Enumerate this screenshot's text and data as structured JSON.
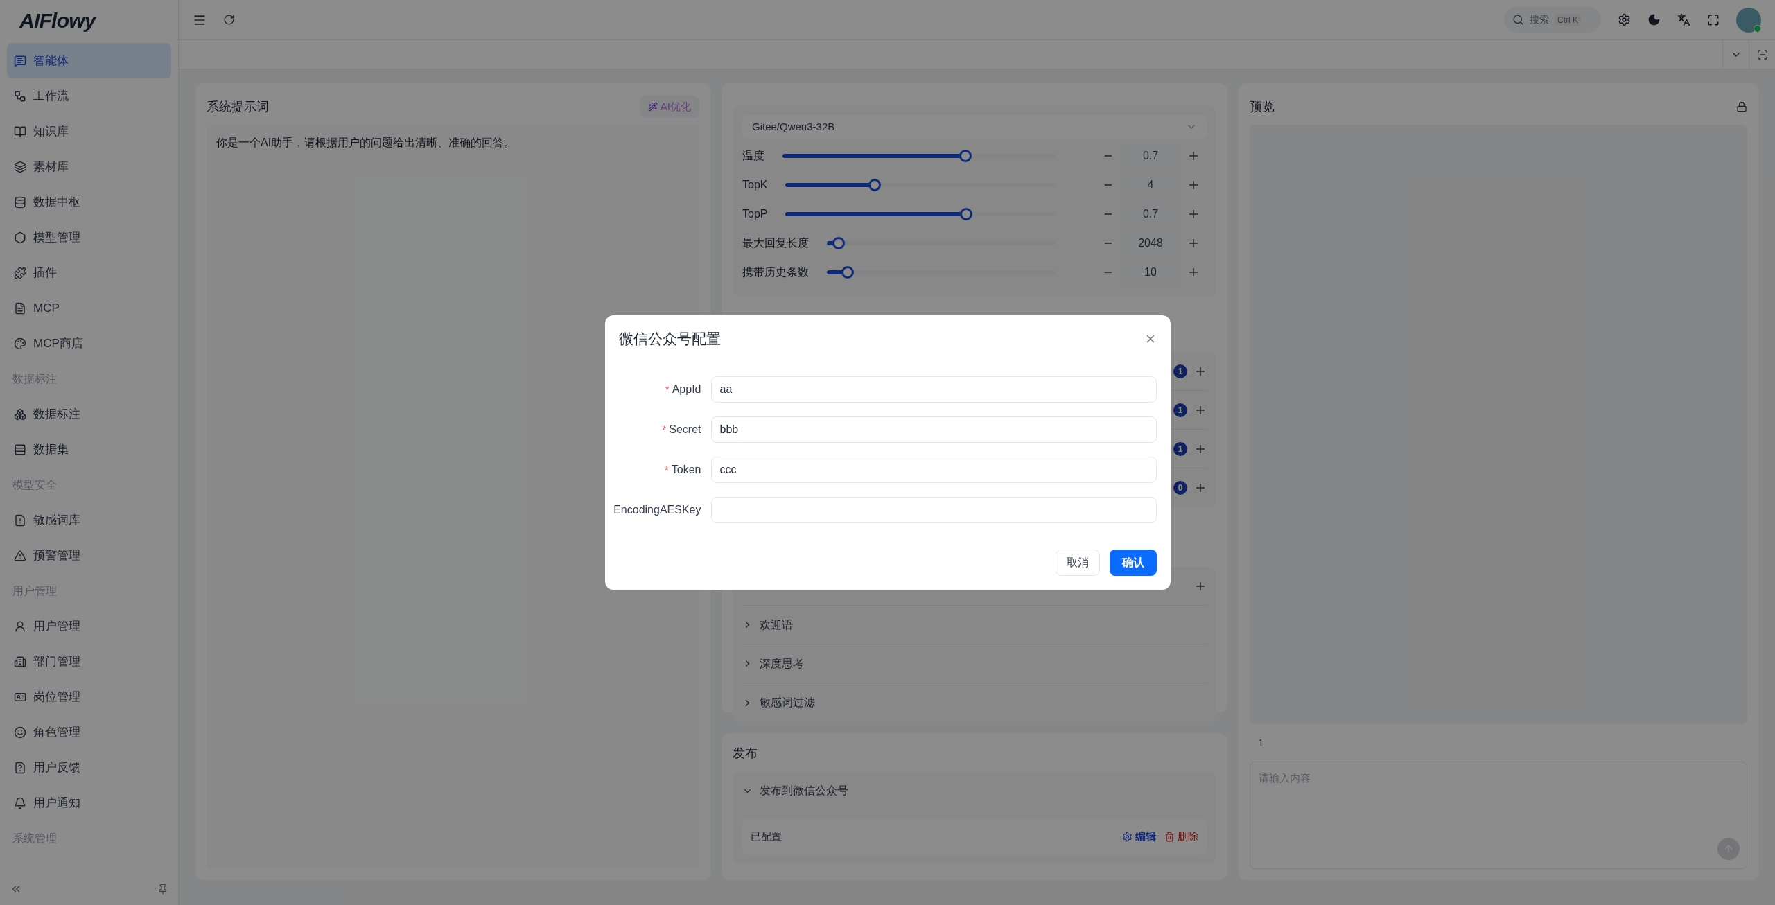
{
  "sidebar": {
    "logo": "AIFlowy",
    "items": [
      {
        "kind": "item",
        "label": "智能体",
        "selected": true
      },
      {
        "kind": "item",
        "label": "工作流",
        "selected": false
      },
      {
        "kind": "item",
        "label": "知识库",
        "selected": false
      },
      {
        "kind": "item",
        "label": "素材库",
        "selected": false
      },
      {
        "kind": "item",
        "label": "数据中枢",
        "selected": false
      },
      {
        "kind": "item",
        "label": "模型管理",
        "selected": false
      },
      {
        "kind": "item",
        "label": "插件",
        "selected": false
      },
      {
        "kind": "item",
        "label": "MCP",
        "selected": false
      },
      {
        "kind": "item",
        "label": "MCP商店",
        "selected": false
      },
      {
        "kind": "group",
        "label": "数据标注"
      },
      {
        "kind": "item",
        "label": "数据标注",
        "selected": false
      },
      {
        "kind": "item",
        "label": "数据集",
        "selected": false
      },
      {
        "kind": "group",
        "label": "模型安全"
      },
      {
        "kind": "item",
        "label": "敏感词库",
        "selected": false
      },
      {
        "kind": "item",
        "label": "预警管理",
        "selected": false
      },
      {
        "kind": "group",
        "label": "用户管理"
      },
      {
        "kind": "item",
        "label": "用户管理",
        "selected": false
      },
      {
        "kind": "item",
        "label": "部门管理",
        "selected": false
      },
      {
        "kind": "item",
        "label": "岗位管理",
        "selected": false
      },
      {
        "kind": "item",
        "label": "角色管理",
        "selected": false
      },
      {
        "kind": "item",
        "label": "用户反馈",
        "selected": false
      },
      {
        "kind": "item",
        "label": "用户通知",
        "selected": false
      },
      {
        "kind": "group",
        "label": "系统管理"
      }
    ]
  },
  "topbar": {
    "search": {
      "placeholder": "搜索",
      "shortcut": "Ctrl K"
    }
  },
  "system_prompt": {
    "title": "系统提示词",
    "ai_button": "AI优化",
    "text": "你是一个AI助手，请根据用户的问题给出清晰、准确的回答。"
  },
  "model": {
    "select": "Gitee/Qwen3-32B",
    "params": [
      {
        "label": "温度",
        "level": 0.67,
        "value": "0.7"
      },
      {
        "label": "TopK",
        "level": 0.33,
        "value": "4"
      },
      {
        "label": "TopP",
        "level": 0.67,
        "value": "0.7"
      },
      {
        "label": "最大回复长度",
        "level": 0.05,
        "value": "2048"
      },
      {
        "label": "携带历史条数",
        "level": 0.09,
        "value": "10"
      }
    ]
  },
  "counted_rows": [
    {
      "count": "1"
    },
    {
      "count": "1"
    },
    {
      "count": "1"
    },
    {
      "count": "0"
    }
  ],
  "collapse_items": [
    {
      "label": "欢迎语",
      "expanded": false
    },
    {
      "label": "深度思考",
      "expanded": false
    },
    {
      "label": "敏感词过滤",
      "expanded": false
    }
  ],
  "publish": {
    "title": "发布",
    "section": {
      "label": "发布到微信公众号",
      "expanded": true,
      "status": "已配置",
      "edit": "编辑",
      "delete": "删除"
    }
  },
  "preview": {
    "title": "预览",
    "counter": "1",
    "input_placeholder": "请输入内容"
  },
  "dialog": {
    "title": "微信公众号配置",
    "fields": [
      {
        "label": "AppId",
        "required_mark": "*",
        "value": "aa"
      },
      {
        "label": "Secret",
        "required_mark": "*",
        "value": "bbb"
      },
      {
        "label": "Token",
        "required_mark": "*",
        "value": "ccc"
      },
      {
        "label": "EncodingAESKey"
      }
    ],
    "cancel": "取消",
    "confirm": "确认"
  }
}
